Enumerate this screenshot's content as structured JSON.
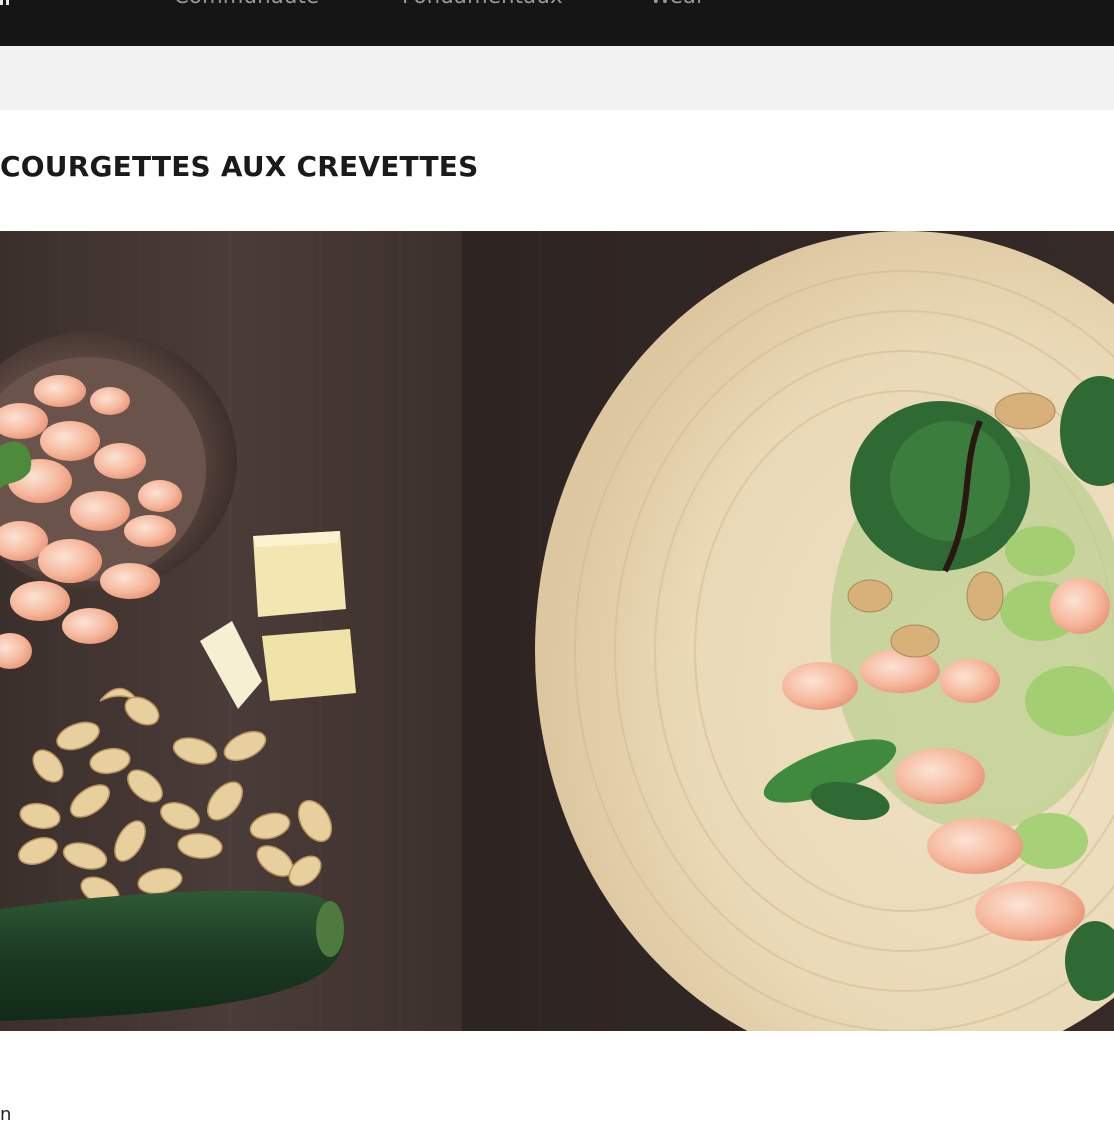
{
  "nav": {
    "items": [
      "Communauté",
      "Fondamentaux",
      "Wear"
    ]
  },
  "article": {
    "title": "COURGETTES AUX CREVETTES"
  },
  "hero": {
    "subject": "courgettes-crevettes-photo"
  },
  "footer": {
    "fragment": "n"
  }
}
